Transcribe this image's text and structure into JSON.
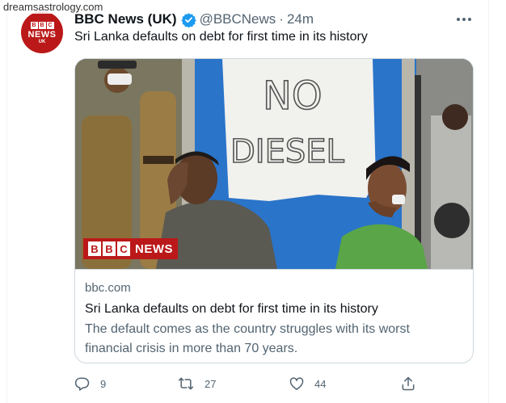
{
  "watermark": "dreamsastrology.com",
  "tweet": {
    "avatar": {
      "bbc": [
        "B",
        "B",
        "C"
      ],
      "news": "NEWS",
      "region": "UK"
    },
    "display_name": "BBC News (UK)",
    "handle": "@BBCNews",
    "separator": "·",
    "time": "24m",
    "text": "Sri Lanka defaults on debt for first time in its history"
  },
  "card": {
    "image_sign_line1": "NO",
    "image_sign_line2": "DIESEL",
    "logo_letters": [
      "B",
      "B",
      "C"
    ],
    "logo_news": "NEWS",
    "domain": "bbc.com",
    "title": "Sri Lanka defaults on debt for first time in its history",
    "description": "The default comes as the country struggles with its worst financial crisis in more than 70 years."
  },
  "actions": {
    "replies": "9",
    "retweets": "27",
    "likes": "44"
  },
  "colors": {
    "bbc_red": "#bb1919",
    "verified_blue": "#1d9bf0",
    "secondary_text": "#536471"
  }
}
